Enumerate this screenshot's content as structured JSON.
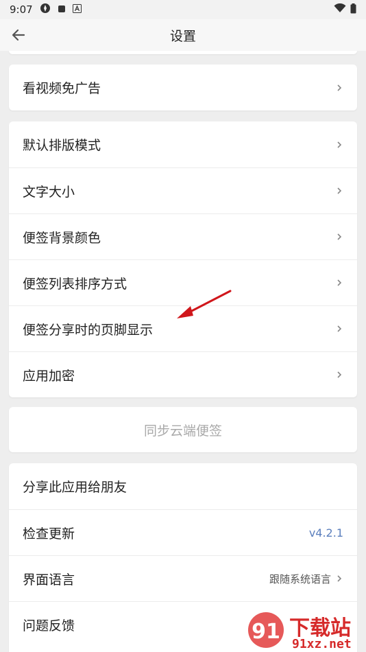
{
  "status": {
    "time": "9:07"
  },
  "header": {
    "title": "设置"
  },
  "ad_card": {
    "label": "看视频免广告"
  },
  "settings": [
    {
      "label": "默认排版模式"
    },
    {
      "label": "文字大小"
    },
    {
      "label": "便签背景颜色"
    },
    {
      "label": "便签列表排序方式"
    },
    {
      "label": "便签分享时的页脚显示"
    },
    {
      "label": "应用加密"
    }
  ],
  "sync": {
    "label": "同步云端便签"
  },
  "misc": {
    "share": "分享此应用给朋友",
    "update": "检查更新",
    "version": "v4.2.1",
    "language": "界面语言",
    "language_value": "跟随系统语言",
    "feedback": "问题反馈"
  },
  "watermark": {
    "brand": "下载站",
    "domain": "91xz.net"
  },
  "colors": {
    "accent_version": "#5b7fbd",
    "annotation_arrow": "#d0161b",
    "sync_text": "#a9a9a9"
  }
}
